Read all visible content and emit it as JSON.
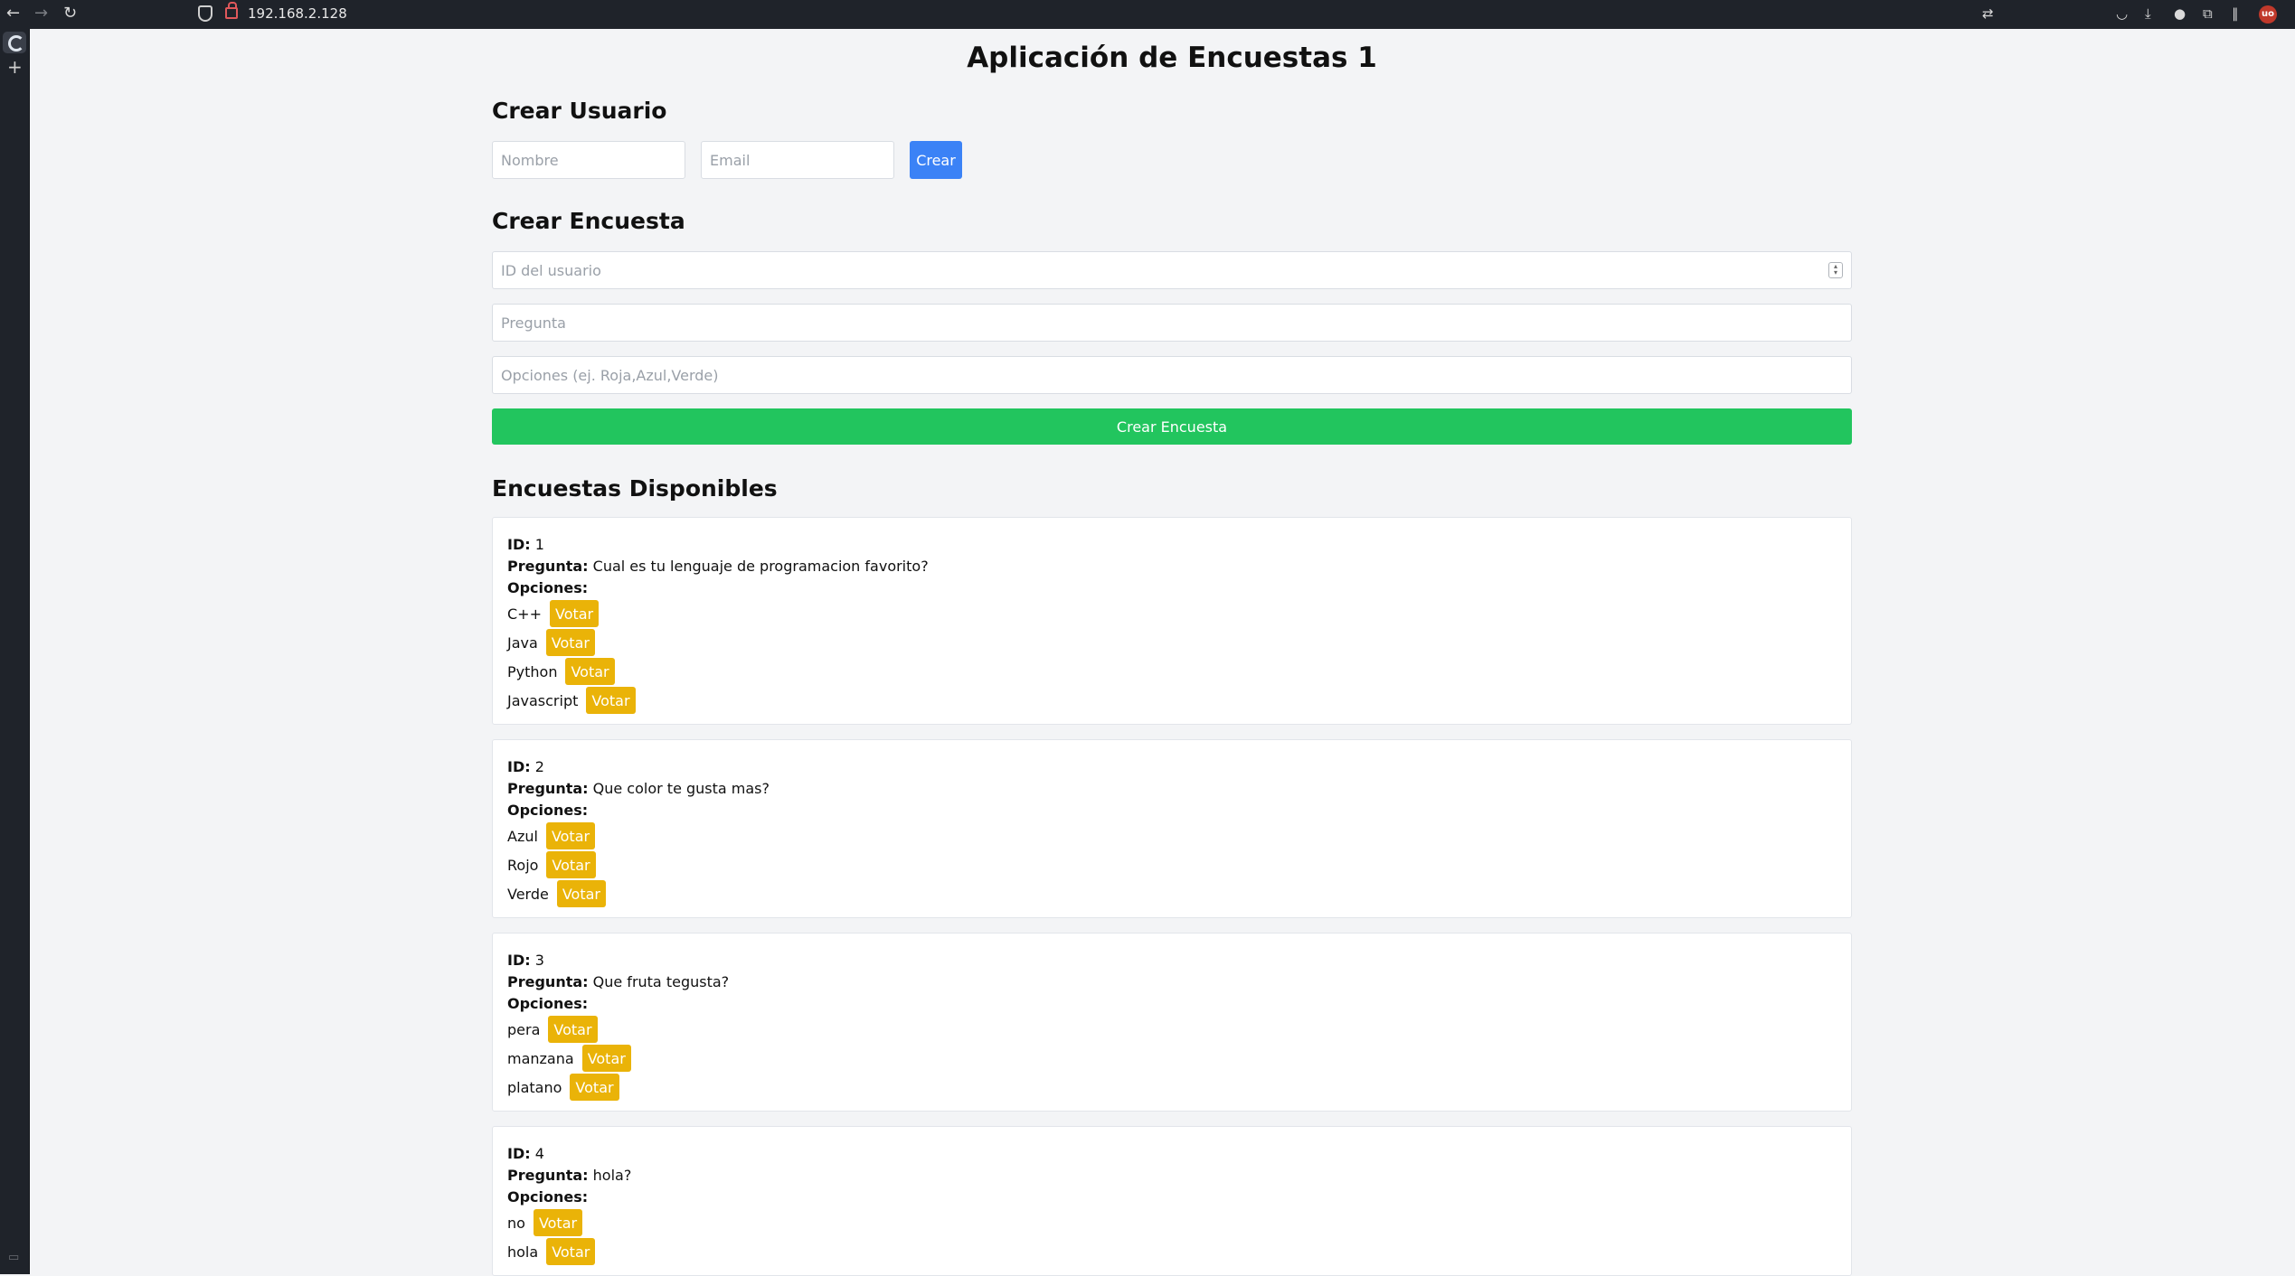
{
  "browser": {
    "url": "192.168.2.128",
    "badge": "uo"
  },
  "page": {
    "title": "Aplicación de Encuestas 1"
  },
  "crear_usuario": {
    "heading": "Crear Usuario",
    "nombre_placeholder": "Nombre",
    "email_placeholder": "Email",
    "button": "Crear"
  },
  "crear_encuesta": {
    "heading": "Crear Encuesta",
    "id_placeholder": "ID del usuario",
    "pregunta_placeholder": "Pregunta",
    "opciones_placeholder": "Opciones (ej. Roja,Azul,Verde)",
    "button": "Crear Encuesta"
  },
  "encuestas": {
    "heading": "Encuestas Disponibles",
    "id_label": "ID:",
    "pregunta_label": "Pregunta:",
    "opciones_label": "Opciones:",
    "vote_label": "Votar",
    "list": [
      {
        "id": "1",
        "pregunta": "Cual es tu lenguaje de programacion favorito?",
        "opciones": [
          "C++",
          "Java",
          "Python",
          "Javascript"
        ]
      },
      {
        "id": "2",
        "pregunta": "Que color te gusta mas?",
        "opciones": [
          "Azul",
          "Rojo",
          "Verde"
        ]
      },
      {
        "id": "3",
        "pregunta": "Que fruta tegusta?",
        "opciones": [
          "pera",
          "manzana",
          "platano"
        ]
      },
      {
        "id": "4",
        "pregunta": "hola?",
        "opciones": [
          "no",
          "hola"
        ]
      }
    ]
  },
  "colors": {
    "primary": "#3b82f6",
    "success": "#22c55e",
    "vote": "#eab308"
  }
}
